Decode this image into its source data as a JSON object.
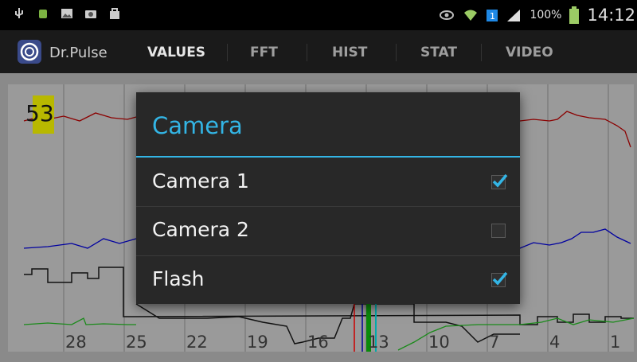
{
  "statusbar": {
    "battery_percent": "100%",
    "time": "14:12"
  },
  "appbar": {
    "app_name": "Dr.Pulse",
    "tabs": [
      {
        "label": "VALUES",
        "active": true
      },
      {
        "label": "FFT",
        "active": false
      },
      {
        "label": "HIST",
        "active": false
      },
      {
        "label": "STAT",
        "active": false
      },
      {
        "label": "VIDEO",
        "active": false
      }
    ]
  },
  "plot": {
    "heart_rate": "53",
    "x_labels": [
      "28",
      "25",
      "22",
      "19",
      "16",
      "13",
      "10",
      "7",
      "4",
      "1"
    ]
  },
  "dialog": {
    "title": "Camera",
    "options": [
      {
        "label": "Camera 1",
        "checked": true
      },
      {
        "label": "Camera 2",
        "checked": false
      },
      {
        "label": "Flash",
        "checked": true
      }
    ]
  },
  "colors": {
    "accent": "#33b5e5",
    "dialog_bg": "#282828",
    "badge": "#b8b800"
  }
}
